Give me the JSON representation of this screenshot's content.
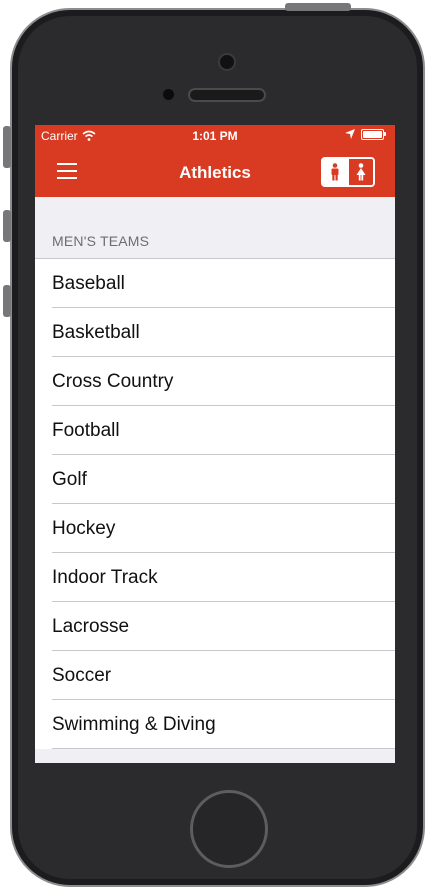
{
  "status": {
    "carrier": "Carrier",
    "time": "1:01 PM"
  },
  "nav": {
    "title": "Athletics"
  },
  "section": {
    "header": "MEN'S TEAMS"
  },
  "teams": [
    "Baseball",
    "Basketball",
    "Cross Country",
    "Football",
    "Golf",
    "Hockey",
    "Indoor Track",
    "Lacrosse",
    "Soccer",
    "Swimming & Diving"
  ],
  "colors": {
    "accent": "#d93a22",
    "background": "#efeff4"
  },
  "icons": {
    "menu": "hamburger-icon",
    "men": "male-figure-icon",
    "women": "female-figure-icon",
    "wifi": "wifi-icon",
    "location": "location-arrow-icon",
    "battery": "battery-icon"
  }
}
